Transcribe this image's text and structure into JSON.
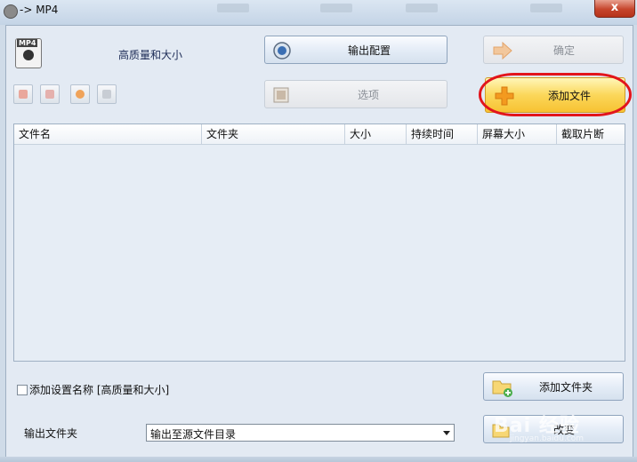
{
  "window": {
    "title": "-> MP4",
    "close_label": "x"
  },
  "header": {
    "preset_label": "高质量和大小"
  },
  "buttons": {
    "output_config": "输出配置",
    "ok": "确定",
    "options": "选项",
    "add_file": "添加文件",
    "add_folder": "添加文件夹",
    "change": "改变"
  },
  "toolbar": {
    "icons": [
      "remove-icon",
      "clear-icon",
      "play-icon",
      "info-icon"
    ]
  },
  "file_list": {
    "columns": [
      "文件名",
      "文件夹",
      "大小",
      "持续时间",
      "屏幕大小",
      "截取片断"
    ]
  },
  "options_panel": {
    "add_setting_name_label": "添加设置名称 [高质量和大小]",
    "add_setting_name_checked": false,
    "output_folder_label": "输出文件夹",
    "output_folder_value": "输出至源文件目录"
  },
  "watermark": {
    "text": "Bai 经验",
    "subtext": "jingyan.baidu.com"
  },
  "colors": {
    "highlight_ring": "#e2141c",
    "add_file_button": "#fbd75a"
  }
}
